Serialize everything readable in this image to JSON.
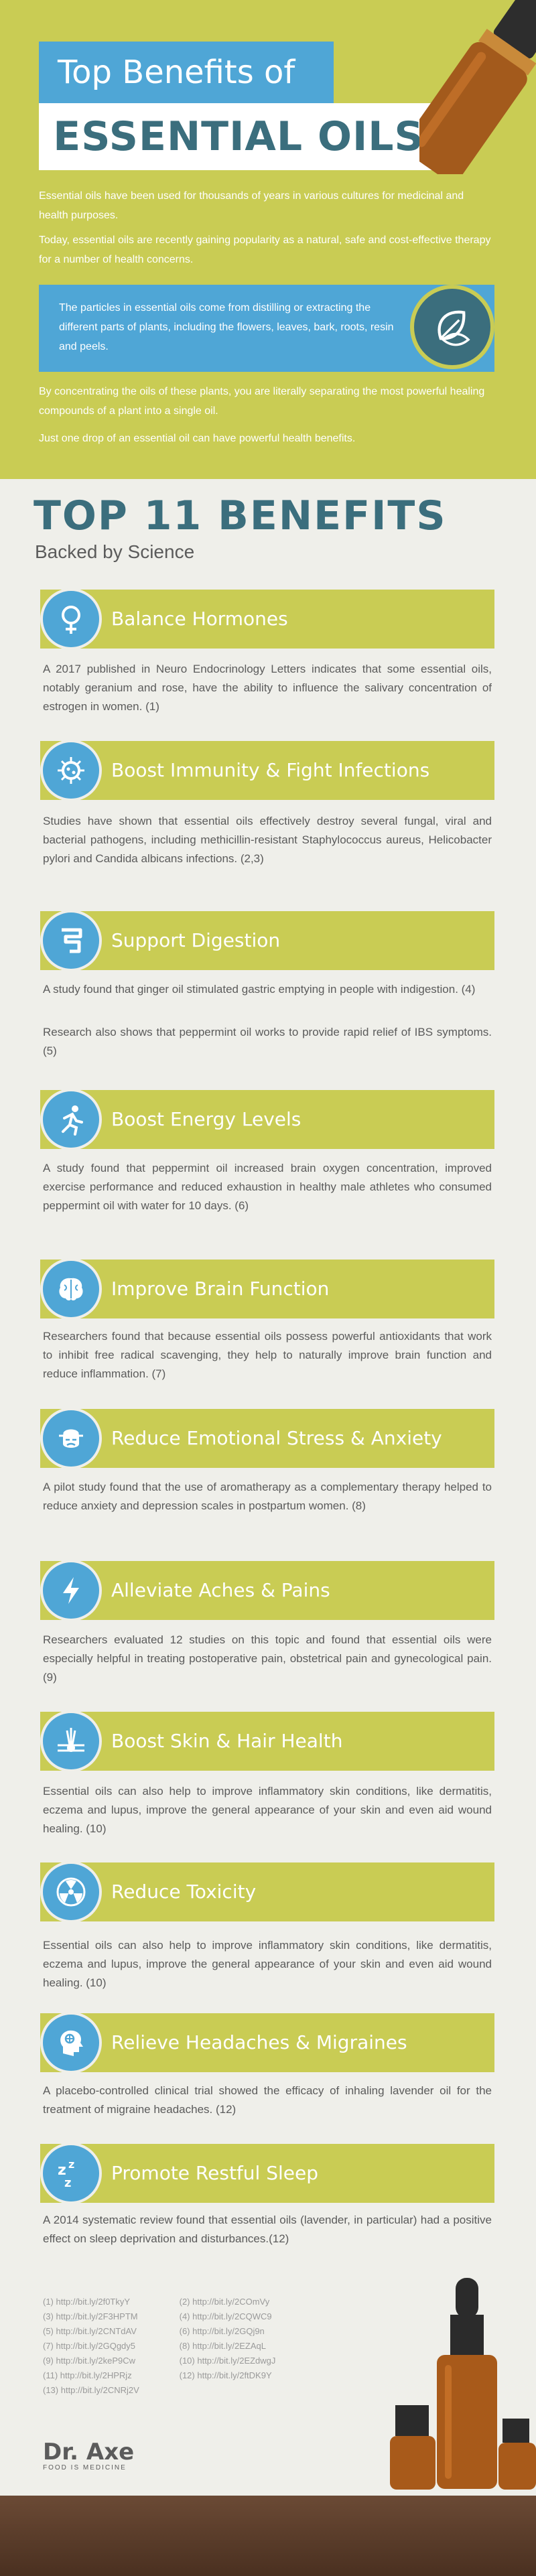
{
  "header": {
    "title_line1": "Top Benefits of",
    "title_line2": "ESSENTIAL OILS",
    "intro_paragraphs": [
      "Essential oils have been used for thousands of years in various cultures for medicinal and health purposes.",
      "Today, essential oils are recently gaining popularity as a natural, safe and cost-effective therapy for a number of health concerns."
    ],
    "callout": "The particles in essential oils come from distilling or extracting the different parts of plants, including the flowers, leaves, bark, roots, resin and peels.",
    "outro_paragraphs": [
      "By concentrating the oils of these plants, you are literally separating the most powerful healing compounds of a plant into a single oil.",
      "Just one drop of an essential oil can have powerful health benefits."
    ],
    "callout_icon": "leaves-icon"
  },
  "section": {
    "title": "TOP 11 BENEFITS",
    "subtitle": "Backed by Science"
  },
  "benefits": [
    {
      "label": "Balance Hormones",
      "icon": "venus-icon",
      "desc": "A 2017 published in Neuro Endocrinology Letters indicates that some essential oils, notably geranium and rose, have the ability to influence the salivary concentration of estrogen in women. (1)"
    },
    {
      "label": "Boost Immunity & Fight Infections",
      "icon": "virus-icon",
      "desc": "Studies have shown that essential oils effectively destroy several fungal, viral and bacterial pathogens, including methicillin-resistant Staphylococcus aureus, Helicobacter pylori and Candida albicans infections. (2,3)"
    },
    {
      "label": "Support Digestion",
      "icon": "intestine-icon",
      "desc": "A study found that ginger oil stimulated gastric emptying in people with indigestion. (4)",
      "desc2": "Research also shows that peppermint oil works to provide rapid relief of IBS symptoms. (5)"
    },
    {
      "label": "Boost Energy Levels",
      "icon": "runner-icon",
      "desc": "A study found that peppermint oil increased brain oxygen concentration, improved exercise performance and reduced exhaustion in healthy male athletes who consumed peppermint oil with water for 10 days. (6)"
    },
    {
      "label": "Improve Brain Function",
      "icon": "brain-icon",
      "desc": "Researchers found that because essential oils possess powerful antioxidants that work to inhibit free radical scavenging, they help to naturally improve brain function and reduce inflammation. (7)"
    },
    {
      "label": "Reduce Emotional Stress & Anxiety",
      "icon": "stressed-head-icon",
      "desc": "A pilot study found that the use of aromatherapy as a complementary therapy helped to reduce anxiety and depression scales in postpartum women. (8)"
    },
    {
      "label": "Alleviate Aches & Pains",
      "icon": "lightning-icon",
      "desc": "Researchers evaluated 12 studies on this topic and found that essential oils were especially helpful in treating postoperative pain, obstetrical pain and gynecological pain. (9)"
    },
    {
      "label": "Boost Skin & Hair Health",
      "icon": "hair-follicle-icon",
      "desc": "Essential oils can also help to improve inflammatory skin conditions, like dermatitis, eczema and lupus, improve the general appearance of your skin and even aid wound healing. (10)"
    },
    {
      "label": "Reduce Toxicity",
      "icon": "radiation-icon",
      "desc": "Essential oils can also help to improve inflammatory skin conditions, like dermatitis, eczema and lupus, improve the general appearance of your skin and even aid wound healing. (10)"
    },
    {
      "label": "Relieve Headaches & Migraines",
      "icon": "headache-icon",
      "desc": "A placebo-controlled clinical trial showed the efficacy of inhaling lavender oil for the treatment of migraine headaches. (12)"
    },
    {
      "label": "Promote Restful Sleep",
      "icon": "sleep-zzz-icon",
      "desc": "A 2014 systematic review found that essential oils (lavender, in particular) had a positive effect on sleep deprivation and disturbances.(12)"
    }
  ],
  "references": {
    "left": [
      "(1) http://bit.ly/2f0TkyY",
      "(3) http://bit.ly/2F3HPTM",
      "(5) http://bit.ly/2CNTdAV",
      "(7) http://bit.ly/2GQgdy5",
      "(9) http://bit.ly/2keP9Cw",
      "(11) http://bit.ly/2HPRjz",
      "(13) http://bit.ly/2CNRj2V"
    ],
    "right": [
      "(2) http://bit.ly/2COmVy",
      "(4) http://bit.ly/2CQWC9",
      "(6) http://bit.ly/2GQj9n",
      "(8) http://bit.ly/2EZAqL",
      "(10) http://bit.ly/2EZdwgJ",
      "(12) http://bit.ly/2ftDK9Y"
    ]
  },
  "logo": {
    "main": "Dr. Axe",
    "sub": "FOOD IS MEDICINE"
  },
  "colors": {
    "olive": "#c9cc54",
    "blue": "#4fa6d6",
    "teal": "#3b6e7d",
    "background": "#efefea"
  }
}
